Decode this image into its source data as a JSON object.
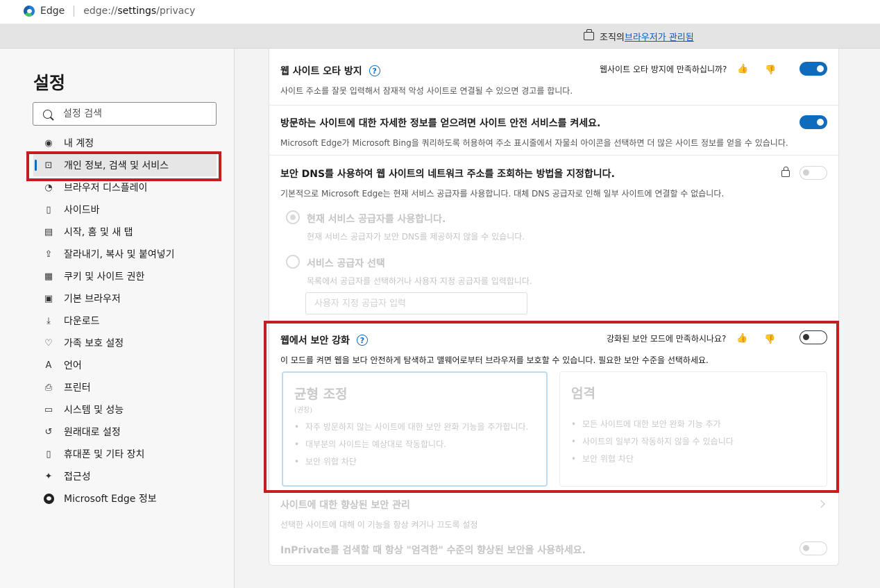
{
  "address_bar": {
    "brand": "Edge",
    "url_prefix": "edge://",
    "url_host": "settings",
    "url_path": "/privacy"
  },
  "managed": {
    "text": "조직의 ",
    "link": "브라우저가 관리됨"
  },
  "sidebar": {
    "title": "설정",
    "search_placeholder": "설정 검색",
    "items": [
      {
        "label": "내 계정",
        "icon": "account-icon"
      },
      {
        "label": "개인 정보, 검색 및 서비스",
        "icon": "lock-icon",
        "active": true
      },
      {
        "label": "브라우저 디스플레이",
        "icon": "palette-icon"
      },
      {
        "label": "사이드바",
        "icon": "sidebar-icon"
      },
      {
        "label": "시작, 홈 및 새 탭",
        "icon": "home-tab-icon"
      },
      {
        "label": "잘라내기, 복사 및 붙여넣기",
        "icon": "share-icon"
      },
      {
        "label": "쿠키 및 사이트 권한",
        "icon": "cookie-icon"
      },
      {
        "label": "기본 브라우저",
        "icon": "browser-icon"
      },
      {
        "label": "다운로드",
        "icon": "download-icon"
      },
      {
        "label": "가족 보호 설정",
        "icon": "family-icon"
      },
      {
        "label": "언어",
        "icon": "language-icon"
      },
      {
        "label": "프린터",
        "icon": "printer-icon"
      },
      {
        "label": "시스템 및 성능",
        "icon": "laptop-icon"
      },
      {
        "label": "원래대로 설정",
        "icon": "reset-icon"
      },
      {
        "label": "휴대폰 및 기타 장치",
        "icon": "phone-icon"
      },
      {
        "label": "접근성",
        "icon": "accessibility-icon"
      },
      {
        "label": "Microsoft Edge 정보",
        "icon": "edge-icon"
      }
    ]
  },
  "typo": {
    "title": "웹 사이트 오타 방지",
    "feedback": "웹사이트 오타 방지에 만족하십니까?",
    "desc": "사이트 주소를 잘못 입력해서 잠재적 악성 사이트로 연결될 수 있으면 경고를 합니다."
  },
  "site_info": {
    "title": "방문하는 사이트에 대한 자세한 정보를 얻으려면 사이트 안전 서비스를 켜세요.",
    "desc": "Microsoft Edge가 Microsoft Bing을 쿼리하도록 허용하여 주소 표시줄에서 자물쇠 아이콘을 선택하면 더 많은 사이트 정보를 얻을 수 있습니다."
  },
  "dns": {
    "title": "보안 DNS를 사용하여 웹 사이트의 네트워크 주소를 조회하는 방법을 지정합니다.",
    "desc": "기본적으로 Microsoft Edge는 현재 서비스 공급자를 사용합니다. 대체 DNS 공급자로 인해 일부 사이트에 연결할 수 없습니다.",
    "opt1_title": "현재 서비스 공급자를 사용합니다.",
    "opt1_desc": "현재 서비스 공급자가 보안 DNS를 제공하지 않을 수 있습니다.",
    "opt2_title": "서비스 공급자 선택",
    "opt2_desc": "목록에서 공급자를 선택하거나 사용자 지정 공급자를 입력합니다.",
    "input_placeholder": "사용자 지정 공급자 입력"
  },
  "enhanced": {
    "title": "웹에서 보안 강화",
    "feedback": "강화된 보안 모드에 만족하시나요?",
    "desc": "이 모드를 켜면 웹을 보다 안전하게 탐색하고 맬웨어로부터 브라우저를 보호할 수 있습니다. 필요한 보안 수준을 선택하세요.",
    "balanced": {
      "title": "균형 조정",
      "sub": "(권장)",
      "items": [
        "자주 방문하지 않는 사이트에 대한 보안 완화 기능을 추가합니다.",
        "대부분의 사이트는 예상대로 작동합니다.",
        "보안 위협 차단"
      ]
    },
    "strict": {
      "title": "엄격",
      "items": [
        "모든 사이트에 대한 보안 완화 기능 추가",
        "사이트의 일부가 작동하지 않을 수 있습니다",
        "보안 위협 차단"
      ]
    }
  },
  "manage_sites": {
    "title": "사이트에 대한 향상된 보안 관리",
    "desc": "선택한 사이트에 대해 이 기능을 항상 켜거나 끄도록 설정"
  },
  "inprivate": {
    "title": "InPrivate를 검색할 때 항상 \"엄격한\" 수준의 향상된 보안을 사용하세요."
  }
}
